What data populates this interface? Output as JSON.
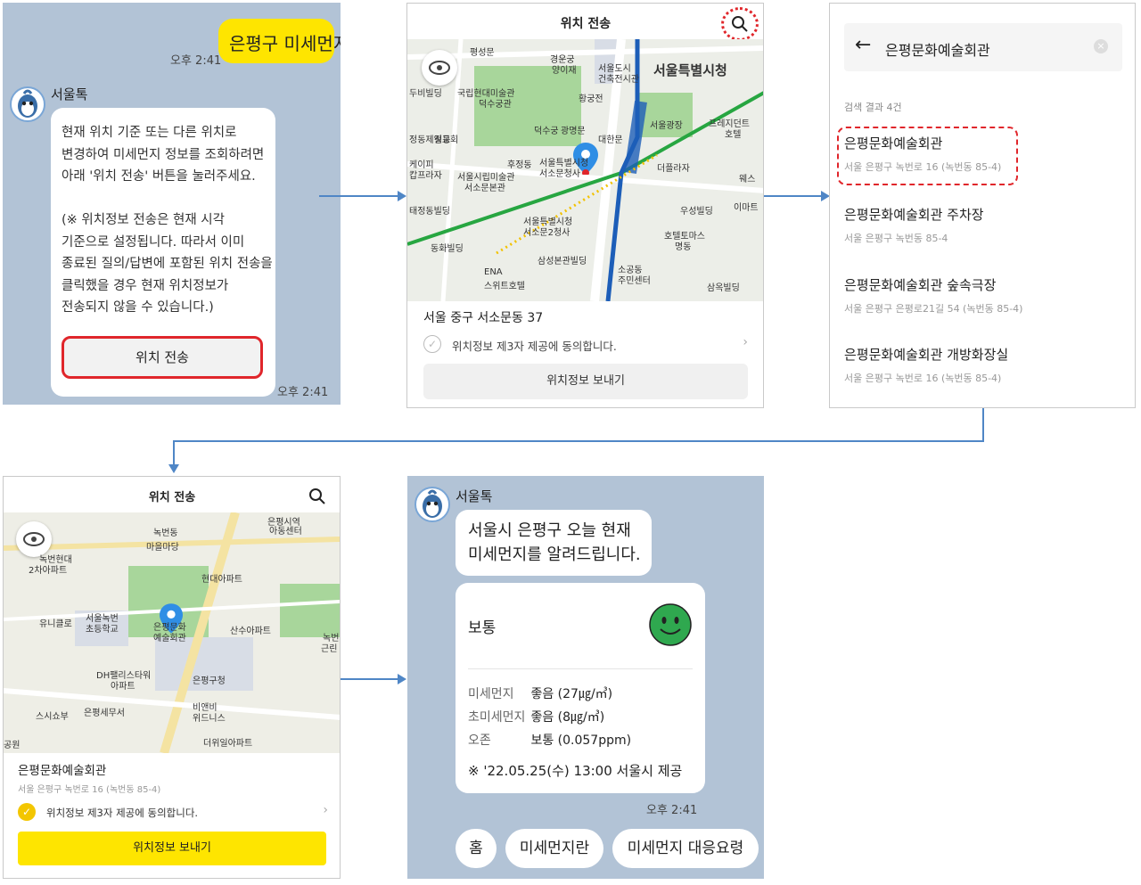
{
  "panel1": {
    "user_message": "은평구 미세먼지",
    "user_time": "오후 2:41",
    "bot_name": "서울톡",
    "bot_message": "현재 위치 기준 또는 다른 위치로\n변경하여 미세먼지 정보를 조회하려면\n아래 '위치 전송' 버튼을 눌러주세요.\n\n(※ 위치정보 전송은 현재 시각\n기준으로 설정됩니다. 따라서 이미\n종료된 질의/답변에 포함된 위치 전송을\n클릭했을 경우 현재 위치정보가\n전송되지 않을 수 있습니다.)",
    "location_button": "위치 전송",
    "bot_time": "오후 2:41"
  },
  "panel2": {
    "title": "위치 전송",
    "address": "서울 중구 서소문동 37",
    "consent": "위치정보 제3자 제공에 동의합니다.",
    "send_button": "위치정보 보내기",
    "map_labels": [
      "평성문",
      "경운궁",
      "양이재",
      "서울도시",
      "건축전시관",
      "서울특별시청",
      "두비빌딩",
      "국립현대미술관",
      "덕수궁관",
      "황궁전",
      "덕수궁",
      "광명문",
      "대한문",
      "서울광장",
      "프레지던트",
      "호텔",
      "정동제일교회",
      "정동",
      "후정동",
      "서울특별시청",
      "서소문청사",
      "더플라자",
      "케이피",
      "캅프라자",
      "서울시립미술관",
      "서소문본관",
      "웨스",
      "이마트",
      "태정동빌딩",
      "서울특별시청",
      "서소문2청사",
      "우성빌딩",
      "호텔토마스",
      "명동",
      "동화빌딩",
      "ENA",
      "스위트호텔",
      "삼성본관빌딩",
      "소공동",
      "주민센터",
      "삼옥빌딩"
    ]
  },
  "panel3": {
    "search_query": "은평문화예술회관",
    "result_count": "검색 결과 4건",
    "results": [
      {
        "name": "은평문화예술회관",
        "address": "서울 은평구 녹번로 16 (녹번동 85-4)"
      },
      {
        "name": "은평문화예술회관 주차장",
        "address": "서울 은평구 녹번동 85-4"
      },
      {
        "name": "은평문화예술회관 숲속극장",
        "address": "서울 은평구 은평로21길 54 (녹번동 85-4)"
      },
      {
        "name": "은평문화예술회관 개방화장실",
        "address": "서울 은평구 녹번로 16 (녹번동 85-4)"
      }
    ]
  },
  "panel4": {
    "title": "위치 전송",
    "place_name": "은평문화예술회관",
    "address": "서울 은평구 녹번로 16 (녹번동 85-4)",
    "consent": "위치정보 제3자 제공에 동의합니다.",
    "send_button": "위치정보 보내기",
    "map_labels": [
      "은평시역",
      "아동센터",
      "녹번동",
      "마을마당",
      "녹번현대",
      "2차아파트",
      "현대아파트",
      "유니클로",
      "서울녹번",
      "초등학교",
      "은평문화",
      "예술회관",
      "산수아파트",
      "녹번",
      "근린",
      "DH팰리스타워",
      "아파트",
      "은평구청",
      "스시쇼부",
      "은평세무서",
      "비앤비",
      "위드니스",
      "공원",
      "더위일아파트"
    ]
  },
  "panel5": {
    "bot_name": "서울톡",
    "bot_message": "서울시 은평구 오늘 현재\n미세먼지를 알려드립니다.",
    "status": "보통",
    "rows": [
      {
        "label": "미세먼지",
        "value": "좋음 (27㎍/㎥)"
      },
      {
        "label": "초미세먼지",
        "value": "좋음 (8㎍/㎥)"
      },
      {
        "label": "오존",
        "value": "보통 (0.057ppm)"
      }
    ],
    "footnote": "※ '22.05.25(수) 13:00 서울시 제공",
    "time": "오후 2:41",
    "quick_replies": [
      "홈",
      "미세먼지란",
      "미세먼지 대응요령"
    ]
  },
  "colors": {
    "chat_bg": "#b2c3d6",
    "user_bubble": "#fee500",
    "highlight_red": "#e0262b",
    "arrow": "#4f86c6",
    "map_park": "#a8d69b",
    "subway_blue": "#1d5eb8",
    "subway_green": "#27a641",
    "face_green": "#2fa84f"
  }
}
